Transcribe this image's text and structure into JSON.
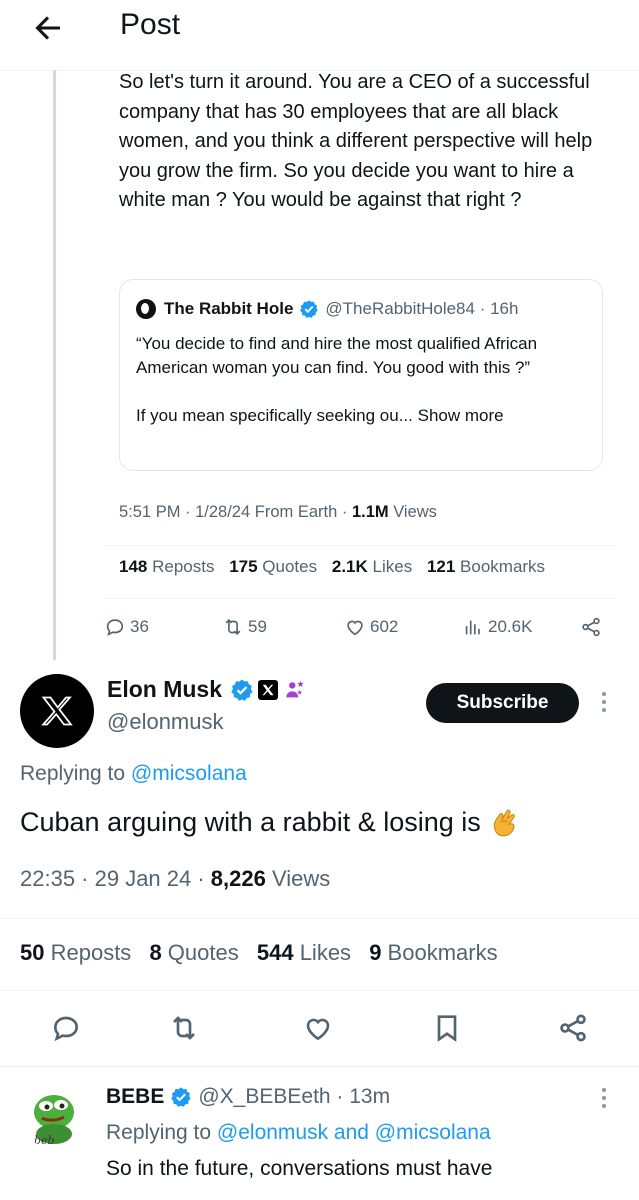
{
  "header": {
    "title": "Post"
  },
  "parent_tweet": {
    "text": "So let's turn it around.  You are a  CEO of a successful company  that has 30 employees that are all black women, and you think a different perspective will help you grow the firm.  So  you decide you want to hire a white man ? You would be against that right ?",
    "quote": {
      "name": "The Rabbit Hole",
      "handle_time": "@TheRabbitHole84 · 16h",
      "text": "“You decide to find and hire the most qualified African American woman you can find. You good with this ?”\n\nIf you mean specifically seeking ou...",
      "show_more": "Show more"
    },
    "meta": {
      "time": "5:51 PM · 1/28/24 From Earth · ",
      "views_count": "1.1M",
      "views_label": " Views"
    },
    "stats": [
      {
        "count": "148",
        "label": " Reposts"
      },
      {
        "count": "175",
        "label": " Quotes"
      },
      {
        "count": "2.1K",
        "label": " Likes"
      },
      {
        "count": "121",
        "label": " Bookmarks"
      }
    ],
    "actions": {
      "replies": "36",
      "reposts": "59",
      "likes": "602",
      "views": "20.6K"
    }
  },
  "main_tweet": {
    "name": "Elon Musk",
    "handle": "@elonmusk",
    "subscribe_label": "Subscribe",
    "replying_prefix": "Replying to ",
    "replying_to": "@micsolana",
    "text": "Cuban arguing with a rabbit & losing is",
    "emoji": "pinching-hand-emoji",
    "time": "22:35 · 29 Jan 24 · ",
    "views_count": "8,226",
    "views_label": " Views",
    "stats": [
      {
        "count": "50",
        "label": " Reposts"
      },
      {
        "count": "8",
        "label": " Quotes"
      },
      {
        "count": "544",
        "label": " Likes"
      },
      {
        "count": "9",
        "label": " Bookmarks"
      }
    ]
  },
  "reply_tweet": {
    "name": "BEBE",
    "handle_time": "@X_BEBEeth · 13m",
    "replying_prefix": "Replying to ",
    "replying_to": "@elonmusk and @micsolana",
    "text": "So in the future, conversations must have",
    "avatar_text": "beb"
  },
  "colors": {
    "accent": "#1d9bf0",
    "muted": "#536471",
    "text": "#0f1419",
    "verified": "#1d9bf0"
  }
}
